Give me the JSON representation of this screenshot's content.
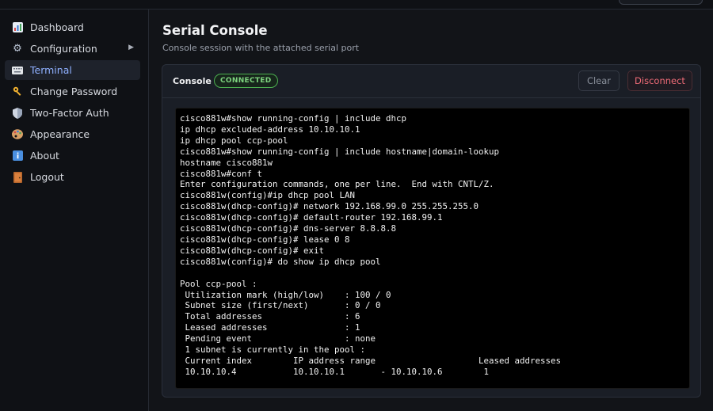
{
  "sidebar": {
    "items": [
      {
        "label": "Dashboard",
        "icon": "bar-chart-icon"
      },
      {
        "label": "Configuration",
        "icon": "gear-icon"
      },
      {
        "label": "Terminal",
        "icon": "keyboard-icon"
      },
      {
        "label": "Change Password",
        "icon": "key-icon"
      },
      {
        "label": "Two-Factor Auth",
        "icon": "shield-icon"
      },
      {
        "label": "Appearance",
        "icon": "palette-icon"
      },
      {
        "label": "About",
        "icon": "info-icon"
      },
      {
        "label": "Logout",
        "icon": "door-icon"
      }
    ],
    "active_item": "Terminal"
  },
  "main": {
    "title": "Serial Console",
    "subtitle": "Console session with the attached serial port"
  },
  "console": {
    "title": "Console",
    "status": "CONNECTED",
    "clear_label": "Clear",
    "disconnect_label": "Disconnect",
    "lines": [
      "cisco881w#show running-config | include dhcp",
      "ip dhcp excluded-address 10.10.10.1",
      "ip dhcp pool ccp-pool",
      "cisco881w#show running-config | include hostname|domain-lookup",
      "hostname cisco881w",
      "cisco881w#conf t",
      "Enter configuration commands, one per line.  End with CNTL/Z.",
      "cisco881w(config)#ip dhcp pool LAN",
      "cisco881w(dhcp-config)# network 192.168.99.0 255.255.255.0",
      "cisco881w(dhcp-config)# default-router 192.168.99.1",
      "cisco881w(dhcp-config)# dns-server 8.8.8.8",
      "cisco881w(dhcp-config)# lease 0 8",
      "cisco881w(dhcp-config)# exit",
      "cisco881w(config)# do show ip dhcp pool",
      "",
      "Pool ccp-pool :",
      " Utilization mark (high/low)    : 100 / 0",
      " Subnet size (first/next)       : 0 / 0",
      " Total addresses                : 6",
      " Leased addresses               : 1",
      " Pending event                  : none",
      " 1 subnet is currently in the pool :",
      " Current index        IP address range                    Leased addresses",
      " 10.10.10.4           10.10.10.1       - 10.10.10.6        1"
    ]
  },
  "colors": {
    "accent": "#8fb0ff",
    "connected": "#7ed47f",
    "danger": "#ee6b77",
    "background": "#121418",
    "terminal_bg": "#000000"
  }
}
